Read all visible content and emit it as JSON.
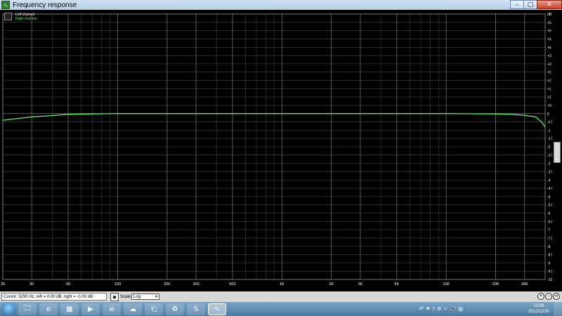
{
  "window": {
    "title": "Frequency response",
    "icon": "frequency-response-app-icon",
    "buttons": {
      "minimize": "–",
      "maximize": "□",
      "close": "✕"
    }
  },
  "legend": {
    "left_channel": "Left channel",
    "right_channel": "Right channel"
  },
  "chart_data": {
    "type": "line",
    "xscale": "log",
    "xlim": [
      20,
      40000
    ],
    "ylim": [
      -10,
      6
    ],
    "xtick_values": [
      20,
      30,
      50,
      100,
      200,
      300,
      500,
      1000,
      2000,
      3000,
      5000,
      10000,
      20000,
      30000
    ],
    "xtick_labels": [
      "20",
      "30",
      "50",
      "100",
      "200",
      "300",
      "500",
      "1K",
      "2K",
      "3K",
      "5K",
      "10K",
      "20K",
      "30K"
    ],
    "ytick_values": [
      6,
      5.5,
      5,
      4.5,
      4,
      3.5,
      3,
      2.5,
      2,
      1.5,
      1,
      0.5,
      0,
      -0.5,
      -1,
      -1.5,
      -2,
      -2.5,
      -3,
      -3.5,
      -4,
      -4.5,
      -5,
      -5.5,
      -6,
      -6.5,
      -7,
      -7.5,
      -8,
      -8.5,
      -9,
      -9.5,
      -10
    ],
    "ytick_labels": [
      "dB",
      "+5.5",
      "+5",
      "+4.5",
      "+4",
      "+3.5",
      "+3",
      "+2.5",
      "+2",
      "+1.5",
      "+1",
      "+0.5",
      "0",
      "-0.5",
      "-1",
      "-1.5",
      "-2",
      "-2.5",
      "-3",
      "-3.5",
      "-4",
      "-4.5",
      "-5",
      "-5.5",
      "-6",
      "-6.5",
      "-7",
      "-7.5",
      "-8",
      "-8.5",
      "-9",
      "-9.5",
      "-10"
    ],
    "grid": true,
    "series": [
      {
        "name": "Left channel",
        "color": "#f0f0f0",
        "x": [
          20,
          30,
          50,
          70,
          100,
          200,
          500,
          1000,
          2000,
          5000,
          10000,
          20000,
          25000,
          30000,
          35000,
          38000,
          40000
        ],
        "y": [
          -0.4,
          -0.2,
          -0.05,
          -0.02,
          0.0,
          0.0,
          0.0,
          0.0,
          0.0,
          0.0,
          0.0,
          -0.02,
          -0.05,
          -0.1,
          -0.2,
          -0.5,
          -0.8
        ]
      },
      {
        "name": "Right channel",
        "color": "#41ff41",
        "x": [
          20,
          30,
          50,
          70,
          100,
          200,
          500,
          1000,
          2000,
          5000,
          10000,
          20000,
          25000,
          30000,
          35000,
          38000,
          40000
        ],
        "y": [
          -0.4,
          -0.2,
          -0.05,
          -0.02,
          0.0,
          0.0,
          0.0,
          0.0,
          0.0,
          0.0,
          0.0,
          -0.02,
          -0.05,
          -0.1,
          -0.2,
          -0.5,
          -0.8
        ]
      }
    ]
  },
  "status": {
    "cursor_text": "Cursor: 5295 Hz, left = 0.00 dB, right = -0.00 dB",
    "save_icon": "save-icon",
    "scale_label": "Scale",
    "scale_value": "Log"
  },
  "taskbar": {
    "apps": [
      {
        "name": "taskbar-app-explorer",
        "icon": "🗀"
      },
      {
        "name": "taskbar-app-ie",
        "icon": "e"
      },
      {
        "name": "taskbar-app-pictures",
        "icon": "▦"
      },
      {
        "name": "taskbar-app-media-player",
        "icon": "▶"
      },
      {
        "name": "taskbar-app-alien",
        "icon": "☠"
      },
      {
        "name": "taskbar-app-cloud",
        "icon": "☁"
      },
      {
        "name": "taskbar-app-network",
        "icon": "⎗"
      },
      {
        "name": "taskbar-app-recycle",
        "icon": "♻"
      },
      {
        "name": "taskbar-app-sync",
        "icon": "S"
      },
      {
        "name": "taskbar-app-frequency-response",
        "icon": "∿"
      }
    ],
    "tray_lang": "JP",
    "clock_time": "23:56",
    "clock_date": "2012/12/30"
  }
}
